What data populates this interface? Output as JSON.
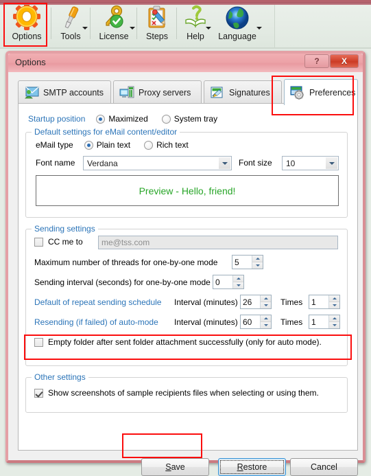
{
  "ribbon": {
    "items": [
      {
        "label": "Options",
        "icon": "gear-icon",
        "dropdown": false
      },
      {
        "label": "Tools",
        "icon": "screwdriver-icon",
        "dropdown": true
      },
      {
        "label": "License",
        "icon": "key-check-icon",
        "dropdown": true
      },
      {
        "label": "Steps",
        "icon": "clipboard-icon",
        "dropdown": false
      },
      {
        "label": "Help",
        "icon": "help-book-icon",
        "dropdown": true
      },
      {
        "label": "Language",
        "icon": "globe-icon",
        "dropdown": true
      }
    ]
  },
  "dialog": {
    "title": "Options",
    "help_button": "?",
    "close_button": "X"
  },
  "tabs": [
    {
      "label": "SMTP accounts",
      "icon": "smtp-account-icon",
      "active": false
    },
    {
      "label": "Proxy servers",
      "icon": "proxy-server-icon",
      "active": false
    },
    {
      "label": "Signatures",
      "icon": "signature-icon",
      "active": false
    },
    {
      "label": "Preferences",
      "icon": "preferences-icon",
      "active": true
    }
  ],
  "preferences": {
    "startup": {
      "label": "Startup position",
      "options": [
        {
          "label": "Maximized",
          "checked": true
        },
        {
          "label": "System tray",
          "checked": false
        }
      ]
    },
    "email_defaults": {
      "group_title": "Default settings for eMail content/editor",
      "email_type_label": "eMail type",
      "email_type_options": [
        {
          "label": "Plain text",
          "checked": true
        },
        {
          "label": "Rich text",
          "checked": false
        }
      ],
      "font_name_label": "Font name",
      "font_name_value": "Verdana",
      "font_size_label": "Font size",
      "font_size_value": "10",
      "preview_text": "Preview - Hello, friend!",
      "preview_color": "#27a527"
    },
    "sending": {
      "group_title": "Sending settings",
      "cc_me_label": "CC me to",
      "cc_me_checked": false,
      "cc_me_value": "me@tss.com",
      "max_threads_label": "Maximum number of threads for one-by-one mode",
      "max_threads_value": "5",
      "interval_label": "Sending interval (seconds) for one-by-one mode",
      "interval_value": "0",
      "repeat_label": "Default of repeat sending schedule",
      "repeat_interval_label": "Interval (minutes)",
      "repeat_interval_value": "26",
      "repeat_times_label": "Times",
      "repeat_times_value": "1",
      "resend_label": "Resending (if failed) of auto-mode",
      "resend_interval_label": "Interval (minutes)",
      "resend_interval_value": "60",
      "resend_times_label": "Times",
      "resend_times_value": "1",
      "empty_folder_label": "Empty folder after sent folder attachment successfully (only for auto mode).",
      "empty_folder_checked": false
    },
    "other": {
      "group_title": "Other settings",
      "show_screenshots_label": "Show screenshots of sample recipients files when selecting or using them.",
      "show_screenshots_checked": true
    }
  },
  "footer": {
    "save": {
      "accel": "S",
      "rest": "ave"
    },
    "restore": {
      "accel": "R",
      "rest": "estore"
    },
    "cancel": {
      "label": "Cancel"
    }
  },
  "colors": {
    "link_blue": "#2b74b8",
    "highlight_red": "#fb0d0d",
    "titlebar_pink": "#eda3a8"
  }
}
